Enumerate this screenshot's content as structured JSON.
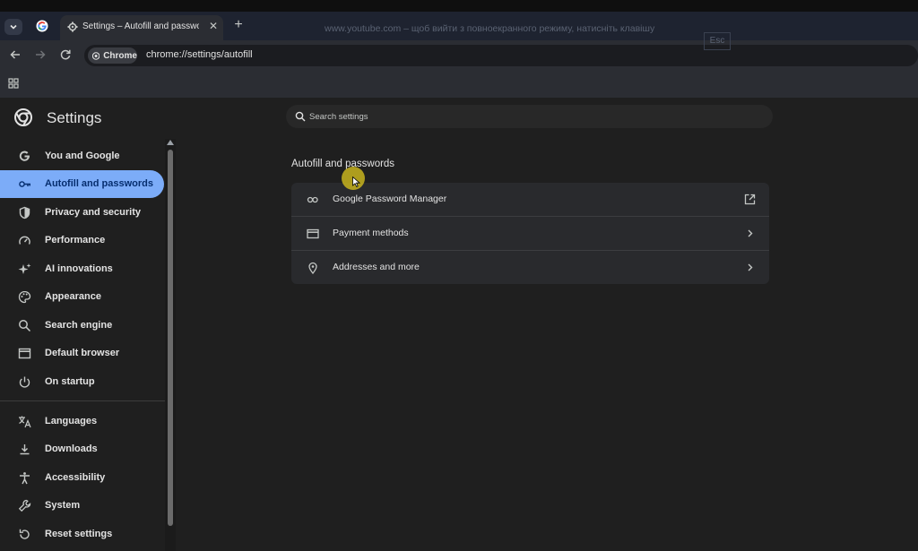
{
  "browser": {
    "tab_title": "Settings – Autofill and passwords",
    "close_symbol": "✕",
    "new_tab_symbol": "+",
    "address_chip": "Chrome",
    "url": "chrome://settings/autofill",
    "fullscreen_notice": "www.youtube.com – щоб вийти з повноекранного режиму, натисніть клавішу",
    "fullscreen_key": "Esc"
  },
  "settings": {
    "title": "Settings",
    "search_placeholder": "Search settings",
    "nav": [
      {
        "label": "You and Google",
        "icon": "google-g-icon"
      },
      {
        "label": "Autofill and passwords",
        "icon": "key-icon",
        "active": true
      },
      {
        "label": "Privacy and security",
        "icon": "shield-icon"
      },
      {
        "label": "Performance",
        "icon": "speedometer-icon"
      },
      {
        "label": "AI innovations",
        "icon": "sparkle-icon"
      },
      {
        "label": "Appearance",
        "icon": "palette-icon"
      },
      {
        "label": "Search engine",
        "icon": "search-icon"
      },
      {
        "label": "Default browser",
        "icon": "browser-window-icon"
      },
      {
        "label": "On startup",
        "icon": "power-icon"
      },
      {
        "label": "Languages",
        "icon": "translate-icon"
      },
      {
        "label": "Downloads",
        "icon": "download-icon"
      },
      {
        "label": "Accessibility",
        "icon": "accessibility-icon"
      },
      {
        "label": "System",
        "icon": "wrench-icon"
      },
      {
        "label": "Reset settings",
        "icon": "reset-icon"
      }
    ],
    "section_title": "Autofill and passwords",
    "rows": [
      {
        "label": "Google Password Manager",
        "icon": "key-icon",
        "action": "open-in-new-icon"
      },
      {
        "label": "Payment methods",
        "icon": "credit-card-icon",
        "action": "chevron-right-icon"
      },
      {
        "label": "Addresses and more",
        "icon": "location-pin-icon",
        "action": "chevron-right-icon"
      }
    ]
  },
  "colors": {
    "accent": "#7cacf8",
    "background": "#1f1f1f",
    "card": "#292a2d"
  }
}
